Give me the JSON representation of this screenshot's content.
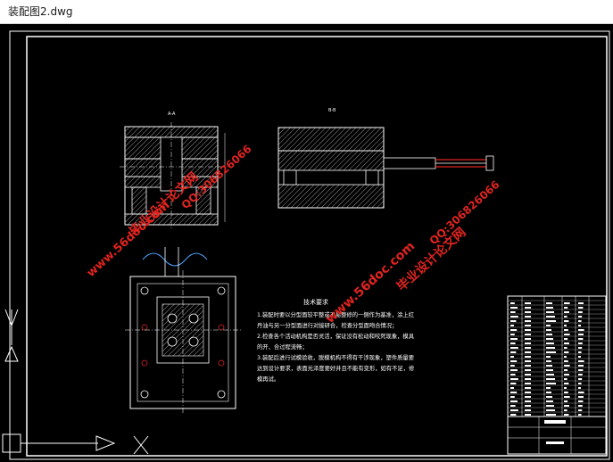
{
  "window": {
    "title": "装配图2.dwg"
  },
  "drawing": {
    "background": "#000000",
    "line_color": "#ffffff",
    "accent_red": "#e0241f",
    "notes": {
      "heading": "技术要求",
      "lines": [
        "1.装配时要以分型面较平整或不易整修的一侧作为基准，涂上红",
        "丹油与另一分型面进行对接研合，检查分型面吻合情况；",
        "2.检查各个活动机构是否灵活，保证没有松动和咬死现象，模具",
        "的开、合过程流畅；",
        "3.装配后进行试模验收，脱模机构不得有干涉现象，塑件质量要",
        "达到设计要求，表面光泽度要好并且不能有变形，如有不足，修",
        "模再试。"
      ]
    },
    "view_labels": {
      "left_section": "A-A",
      "right_section": "B-B"
    }
  },
  "watermarks": {
    "site": "www.56doc.com",
    "qq": "QQ:306826066",
    "brand": "毕业设计论文网"
  }
}
